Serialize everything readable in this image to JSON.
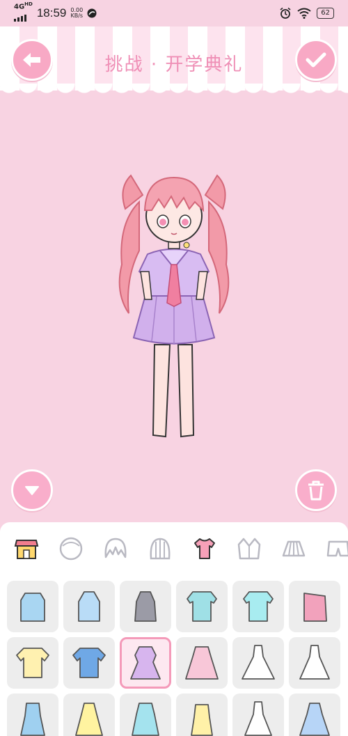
{
  "status": {
    "network": "4G",
    "network_sub": "HD",
    "time": "18:59",
    "speed_value": "0.00",
    "speed_unit": "KB/s",
    "battery": "62"
  },
  "header": {
    "title": "挑战 · 开学典礼",
    "back_icon": "arrow-left-icon",
    "confirm_icon": "check-icon"
  },
  "stage": {
    "collapse_icon": "triangle-down-icon",
    "delete_icon": "trash-icon"
  },
  "categories": [
    {
      "name": "shop",
      "icon": "shop-icon"
    },
    {
      "name": "face",
      "icon": "face-icon"
    },
    {
      "name": "hair-front",
      "icon": "hair-front-icon"
    },
    {
      "name": "hair-back",
      "icon": "hair-back-icon"
    },
    {
      "name": "top",
      "icon": "tshirt-icon",
      "active": true
    },
    {
      "name": "jacket",
      "icon": "jacket-icon"
    },
    {
      "name": "skirt",
      "icon": "skirt-icon"
    },
    {
      "name": "pants",
      "icon": "pants-icon"
    }
  ],
  "items": [
    {
      "name": "blue-sweater",
      "color": "#a9d6f2"
    },
    {
      "name": "lightblue-tank",
      "color": "#b9dcf7"
    },
    {
      "name": "gray-tank",
      "color": "#9b9ba6"
    },
    {
      "name": "aqua-hoodie",
      "color": "#9fe0e6"
    },
    {
      "name": "mint-shirt",
      "color": "#a8ecf0"
    },
    {
      "name": "pink-offshoulder",
      "color": "#f2a2bc"
    },
    {
      "name": "yellow-tee",
      "color": "#fff1b0"
    },
    {
      "name": "blue-stripe-tee",
      "color": "#6fa8e6"
    },
    {
      "name": "sailor-uniform",
      "color": "#d7b5ee",
      "selected": true
    },
    {
      "name": "pink-dress",
      "color": "#f8c7d8"
    },
    {
      "name": "white-dress",
      "color": "#ffffff"
    },
    {
      "name": "white-bow-dress",
      "color": "#ffffff"
    },
    {
      "name": "blue-overall",
      "color": "#9fd0f0"
    },
    {
      "name": "yellow-sundress",
      "color": "#fff3a0"
    },
    {
      "name": "aqua-dress",
      "color": "#a4e3ee"
    },
    {
      "name": "lemon-dress",
      "color": "#fff1a8"
    },
    {
      "name": "white-gown",
      "color": "#ffffff"
    },
    {
      "name": "blue-gown",
      "color": "#b7d5f7"
    }
  ]
}
